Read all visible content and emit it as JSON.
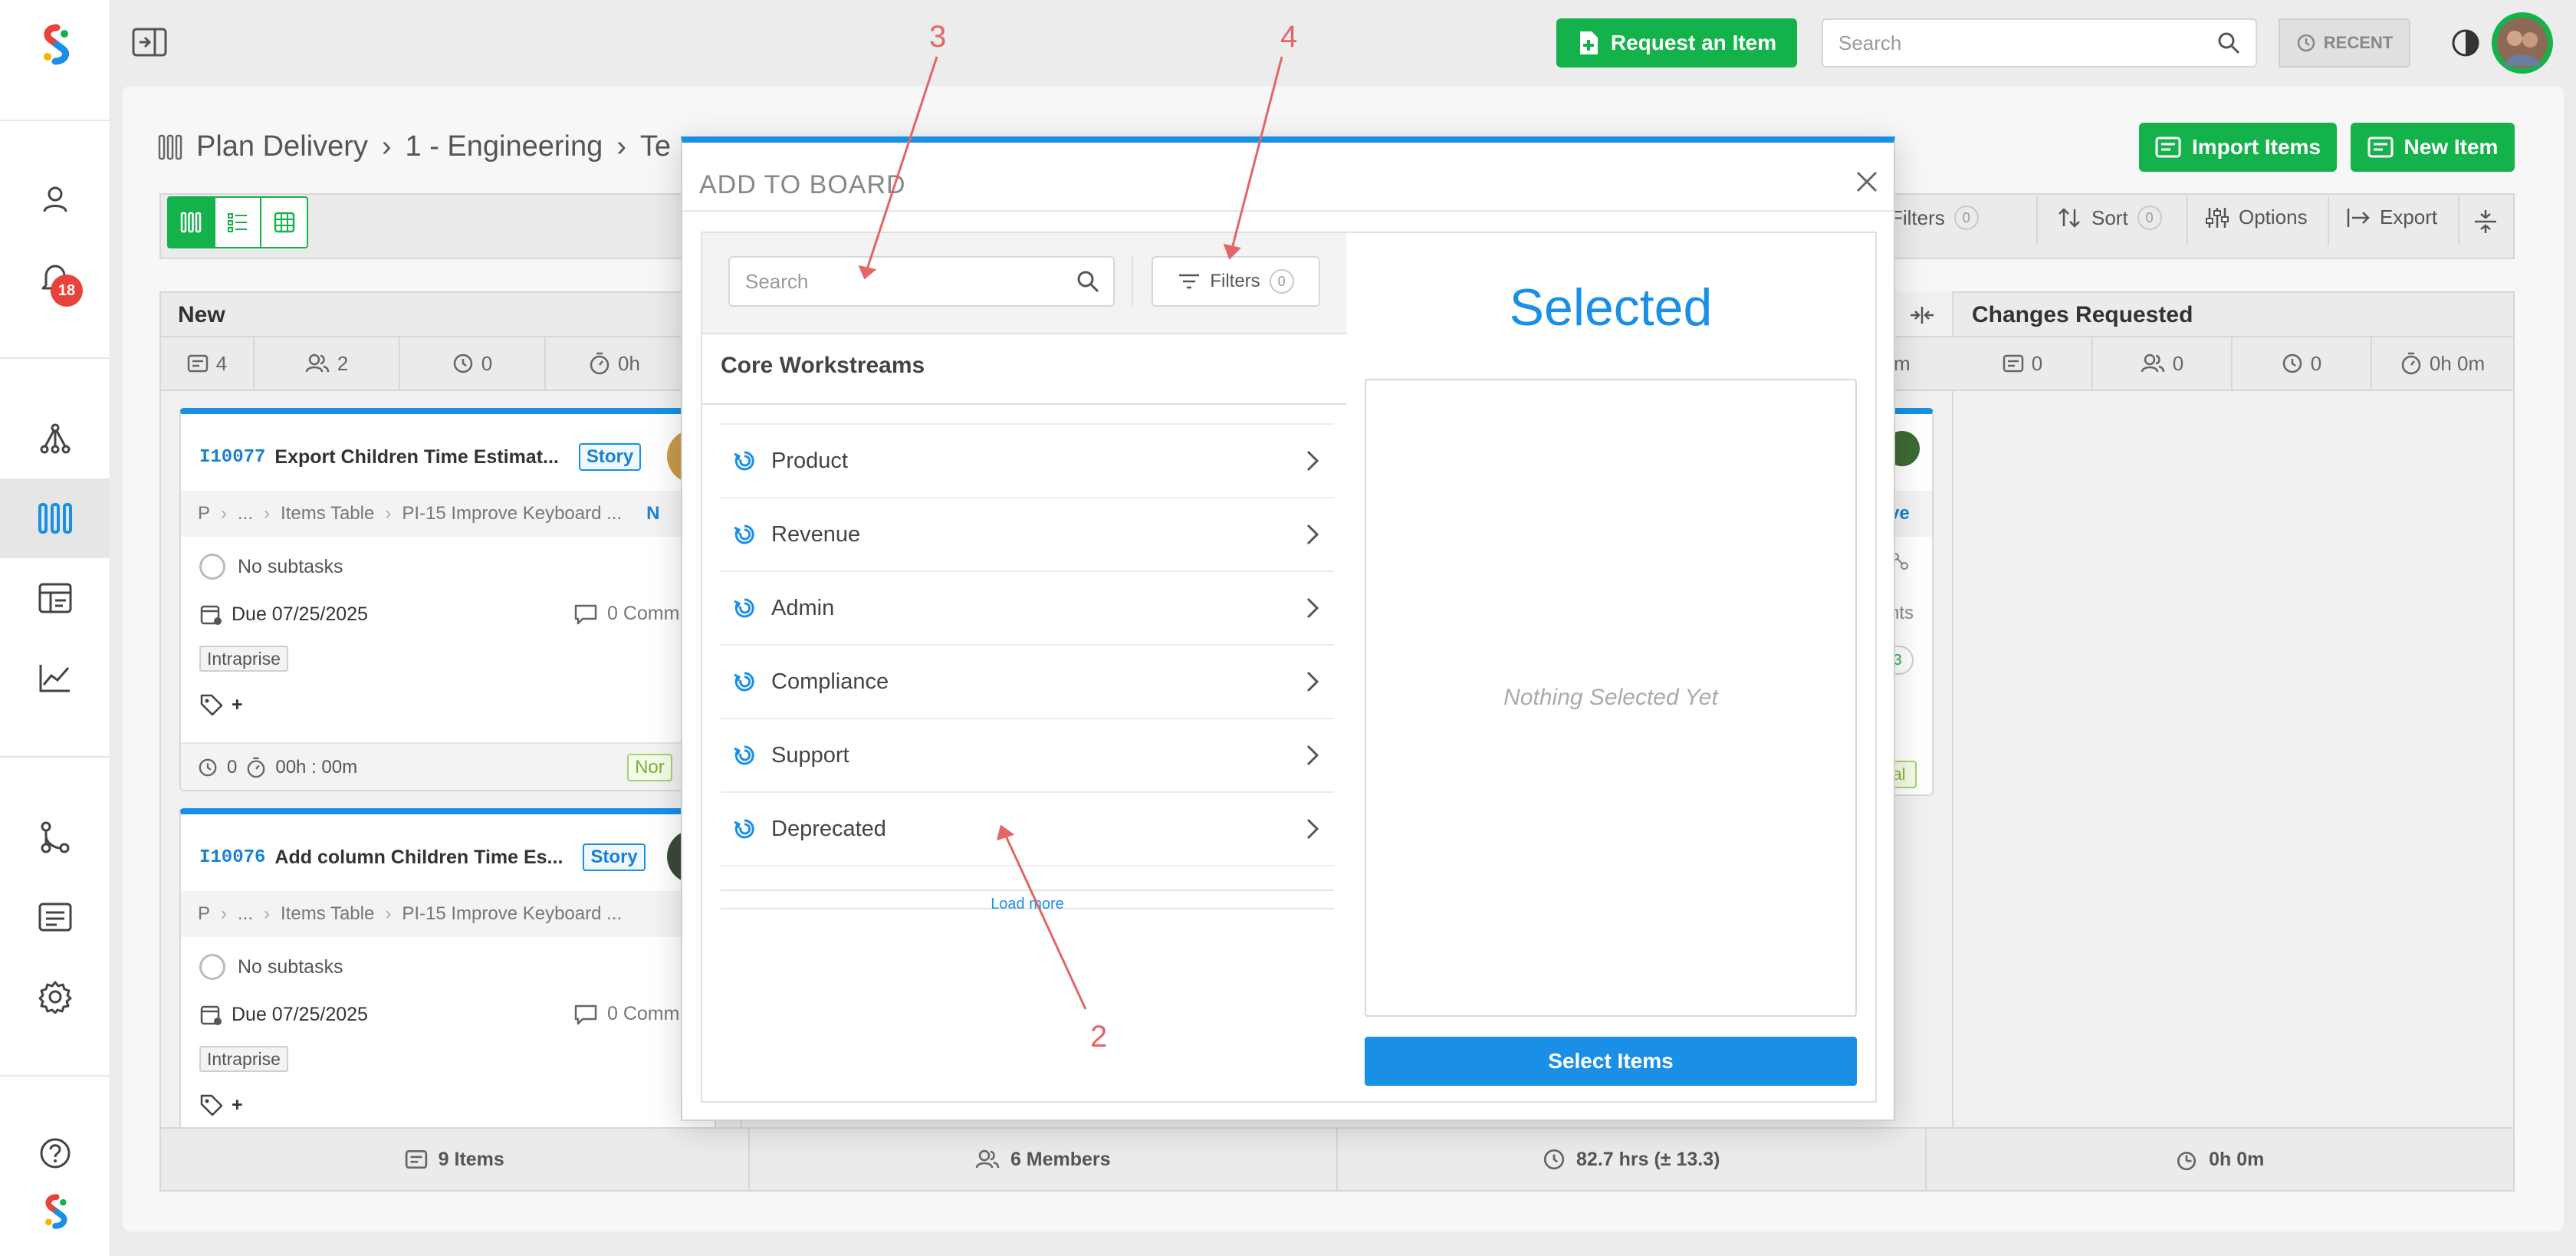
{
  "topbar": {
    "request_label": "Request an Item",
    "search_placeholder": "Search",
    "recent_label": "RECENT"
  },
  "notifications": {
    "count": "18"
  },
  "breadcrumb": {
    "root": "Plan Delivery",
    "level1": "1 - Engineering",
    "level2": "Te"
  },
  "actions": {
    "import_label": "Import Items",
    "new_label": "New Item"
  },
  "toolbar": {
    "filters_label": "Filters",
    "filters_count": "0",
    "sort_label": "Sort",
    "sort_count": "0",
    "options_label": "Options",
    "export_label": "Export"
  },
  "columns": {
    "new": {
      "title": "New",
      "stats": [
        "4",
        "2",
        "0",
        "0h"
      ]
    },
    "changes": {
      "title": "Changes Requested",
      "stats": [
        "0",
        "0",
        "0",
        "0h 0m"
      ]
    },
    "middle_partial": {
      "stat_tail": "m",
      "crumb_tail": "ve",
      "text_tail": "nts",
      "badge_tail": "3",
      "tag_tail": "al"
    }
  },
  "cards": [
    {
      "id": "I10077",
      "title": "Export Children Time Estimat...",
      "type": "Story",
      "crumb": [
        "P",
        "...",
        "Items Table",
        "PI-15 Improve Keyboard ..."
      ],
      "crumb_tail": "N",
      "subtasks": "No subtasks",
      "due": "Due 07/25/2025",
      "comments": "0 Comm",
      "tag": "Intraprise",
      "tag_add": "+",
      "footer_count": "0",
      "footer_time": "00h : 00m",
      "priority": "Nor"
    },
    {
      "id": "I10076",
      "title": "Add column Children Time Es...",
      "type": "Story",
      "crumb": [
        "P",
        "...",
        "Items Table",
        "PI-15 Improve Keyboard ..."
      ],
      "crumb_tail": "",
      "subtasks": "No subtasks",
      "due": "Due 07/25/2025",
      "comments": "0 Comm",
      "tag": "Intraprise",
      "tag_add": "+"
    }
  ],
  "footer": {
    "items": "9 Items",
    "members": "6 Members",
    "hours": "82.7 hrs (± 13.3)",
    "time": "0h 0m"
  },
  "modal": {
    "title": "ADD TO BOARD",
    "search_placeholder": "Search",
    "filters_label": "Filters",
    "filters_count": "0",
    "section_title": "Core Workstreams",
    "workstreams": [
      "Product",
      "Revenue",
      "Admin",
      "Compliance",
      "Support",
      "Deprecated"
    ],
    "load_more": "Load more",
    "selected_title": "Selected",
    "empty_text": "Nothing Selected Yet",
    "select_button": "Select Items"
  },
  "annotations": [
    "3",
    "4",
    "2"
  ],
  "colors": {
    "accent": "#1a8fe6",
    "brand_green": "#14b24a",
    "alert": "#e8433a",
    "annotation": "#e46565"
  }
}
